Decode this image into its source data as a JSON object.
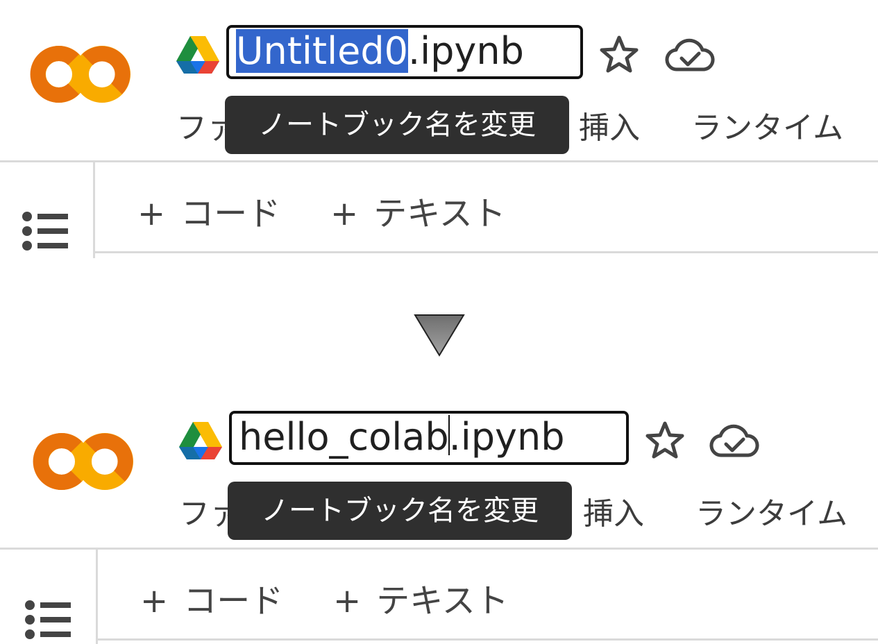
{
  "before": {
    "notebook_name_selected": "Untitled0",
    "notebook_extension": ".ipynb",
    "tooltip": "ノートブック名を変更",
    "menu": {
      "file_partial": "ファ",
      "insert": "挿入",
      "runtime": "ランタイム"
    },
    "toolbar": {
      "add_code": "コード",
      "add_text": "テキスト",
      "plus": "+"
    }
  },
  "after": {
    "notebook_name": "hello_colab",
    "notebook_extension": ".ipynb",
    "tooltip": "ノートブック名を変更",
    "menu": {
      "file_partial": "ファ",
      "insert": "挿入",
      "runtime": "ランタイム"
    },
    "toolbar": {
      "add_code": "コード",
      "add_text": "テキスト",
      "plus": "+"
    }
  },
  "icons": {
    "logo": "colab-logo",
    "drive": "google-drive-icon",
    "star": "star-icon",
    "cloud": "cloud-saved-icon",
    "toc": "table-of-contents-icon",
    "transition": "down-arrow-icon"
  },
  "colors": {
    "selection": "#3366cc",
    "tooltip_bg": "#2f2f2f",
    "colab_orange": "#e8710a",
    "colab_yellow": "#f9ab00",
    "divider": "#dadada"
  }
}
